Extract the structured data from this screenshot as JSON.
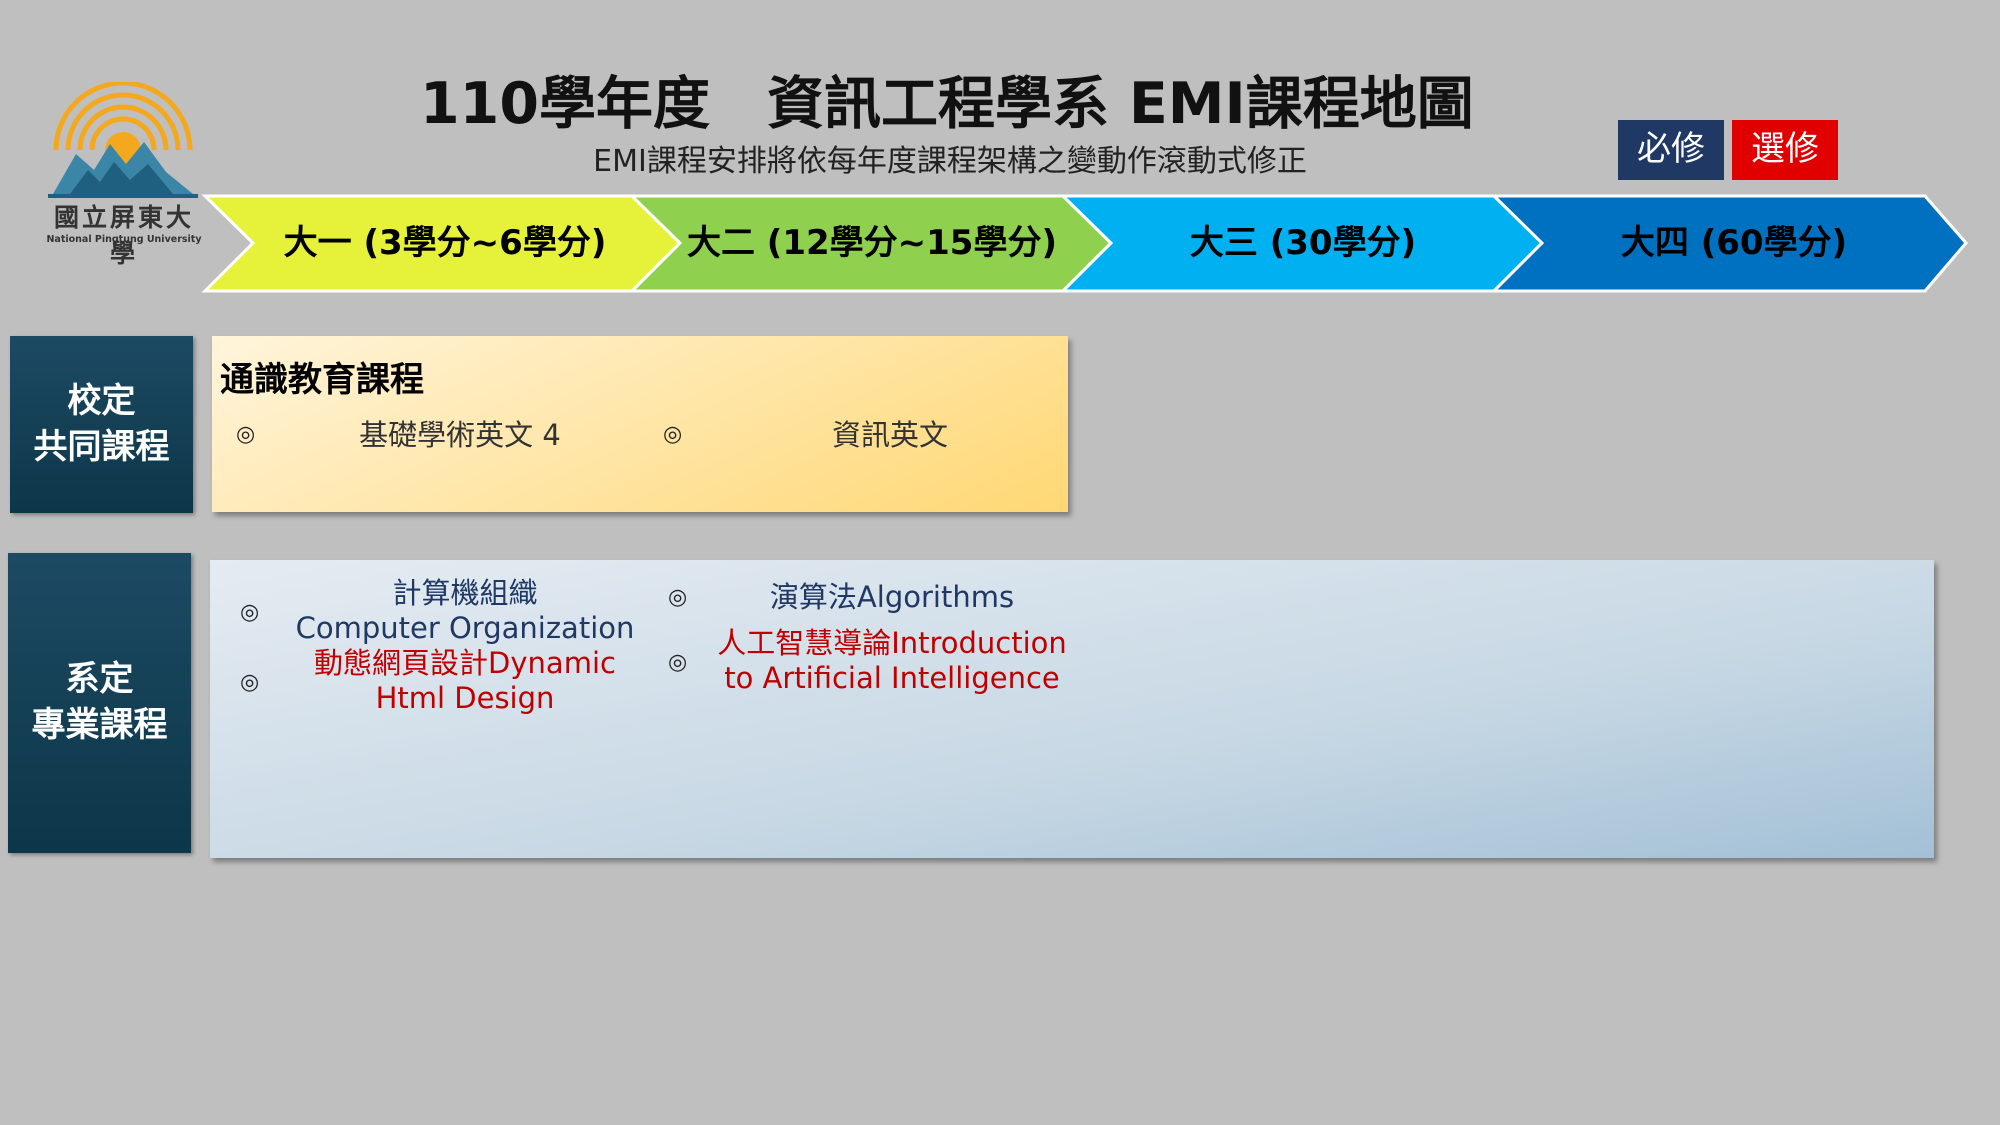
{
  "logo": {
    "name_cn": "國立屏東大學",
    "name_en": "National Pingtung University"
  },
  "title": "110學年度　資訊工程學系 EMI課程地圖",
  "subtitle": "EMI課程安排將依每年度課程架構之變動作滾動式修正",
  "legend": {
    "required": "必修",
    "elective": "選修"
  },
  "years": [
    {
      "label": "大一 (3學分~6學分)",
      "color": "#e6f23a"
    },
    {
      "label": "大二 (12學分~15學分)",
      "color": "#8fd14f"
    },
    {
      "label": "大三 (30學分)",
      "color": "#00b0f0"
    },
    {
      "label": "大四 (60學分)",
      "color": "#0070c0"
    }
  ],
  "rows": {
    "school": {
      "label_line1": "校定",
      "label_line2": "共同課程",
      "heading": "通識教育課程",
      "courses": [
        {
          "bullet": "◎",
          "name": "基礎學術英文 4"
        },
        {
          "bullet": "◎",
          "name": "資訊英文"
        }
      ]
    },
    "dept": {
      "label_line1": "系定",
      "label_line2": "專業課程",
      "courses": [
        {
          "bullet": "◎",
          "line1": "計算機組織",
          "line2": "Computer Organization",
          "type": "required"
        },
        {
          "bullet": "◎",
          "line1": "動態網頁設計Dynamic",
          "line2": "Html Design",
          "type": "elective"
        },
        {
          "bullet": "◎",
          "line1": "演算法Algorithms",
          "type": "required"
        },
        {
          "bullet": "◎",
          "line1": "人工智慧導論Introduction",
          "line2": "to Artificial Intelligence",
          "type": "elective"
        }
      ]
    }
  },
  "colors": {
    "required": "#1f3864",
    "elective": "#c00000",
    "side_label": "#0c3649"
  },
  "icons": {
    "bullet": "double-circle-icon",
    "logo": "sun-mountain-logo-icon"
  }
}
